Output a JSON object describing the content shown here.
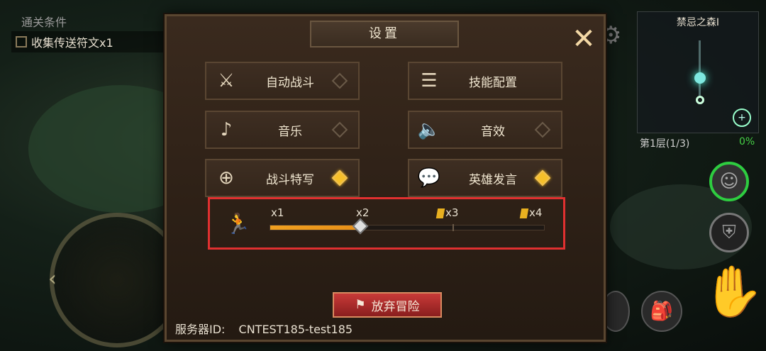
{
  "objective": {
    "title": "通关条件",
    "task": "收集传送符文x1"
  },
  "minimap": {
    "name": "禁忌之森Ⅰ",
    "floor": "第1层(1/3)",
    "progress": "0%"
  },
  "dialog": {
    "title": "设置",
    "options": [
      {
        "label": "自动战斗",
        "icon": "crossed-axes-icon",
        "enabled": false
      },
      {
        "label": "技能配置",
        "icon": "sliders-icon",
        "enabled": false
      },
      {
        "label": "音乐",
        "icon": "music-note-icon",
        "enabled": false
      },
      {
        "label": "音效",
        "icon": "speaker-icon",
        "enabled": false
      },
      {
        "label": "战斗特写",
        "icon": "magnifier-plus-icon",
        "enabled": true
      },
      {
        "label": "英雄发言",
        "icon": "speech-bubble-icon",
        "enabled": true
      }
    ],
    "speed": {
      "labels": [
        "x1",
        "x2",
        "x3",
        "x4"
      ],
      "locked": [
        false,
        false,
        true,
        true
      ],
      "current": 2,
      "fill_fraction": 0.33
    },
    "abandon_label": "放弃冒险",
    "server_label": "服务器ID:",
    "server_id": "CNTEST185-test185"
  },
  "colors": {
    "accent": "#f6c02a",
    "highlight_box": "#e03030",
    "abandon": "#b8302e"
  }
}
